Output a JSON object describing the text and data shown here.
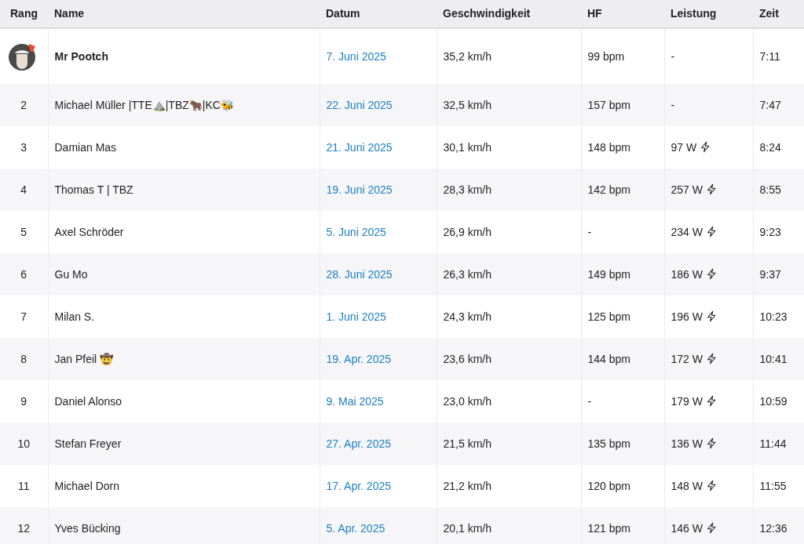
{
  "table": {
    "columns": [
      "Rang",
      "Name",
      "Datum",
      "Geschwindigkeit",
      "HF",
      "Leistung",
      "Zeit"
    ],
    "rows": [
      {
        "kind": "own",
        "name": "Mr Pootch",
        "date": "7. Juni 2025",
        "speed": "35,2 km/h",
        "hr": "99 bpm",
        "power": "-",
        "power_icon": false,
        "time": "7:11"
      },
      {
        "kind": "rank",
        "rank": "2",
        "name": "Michael Müller |TTE⛰️|TBZ🐂|KC🐝",
        "date": "22. Juni 2025",
        "speed": "32,5 km/h",
        "hr": "157 bpm",
        "power": "-",
        "power_icon": false,
        "time": "7:47"
      },
      {
        "kind": "rank",
        "rank": "3",
        "name": "Damian Mas",
        "date": "21. Juni 2025",
        "speed": "30,1 km/h",
        "hr": "148 bpm",
        "power": "97 W",
        "power_icon": true,
        "time": "8:24"
      },
      {
        "kind": "rank",
        "rank": "4",
        "name": "Thomas T | TBZ",
        "date": "19. Juni 2025",
        "speed": "28,3 km/h",
        "hr": "142 bpm",
        "power": "257 W",
        "power_icon": true,
        "time": "8:55"
      },
      {
        "kind": "rank",
        "rank": "5",
        "name": "Axel Schröder",
        "date": "5. Juni 2025",
        "speed": "26,9 km/h",
        "hr": "-",
        "power": "234 W",
        "power_icon": true,
        "time": "9:23"
      },
      {
        "kind": "rank",
        "rank": "6",
        "name": "Gu Mo",
        "date": "28. Juni 2025",
        "speed": "26,3 km/h",
        "hr": "149 bpm",
        "power": "186 W",
        "power_icon": true,
        "time": "9:37"
      },
      {
        "kind": "rank",
        "rank": "7",
        "name": "Milan S.",
        "date": "1. Juni 2025",
        "speed": "24,3 km/h",
        "hr": "125 bpm",
        "power": "196 W",
        "power_icon": true,
        "time": "10:23"
      },
      {
        "kind": "rank",
        "rank": "8",
        "name": "Jan Pfeil 🤠",
        "date": "19. Apr. 2025",
        "speed": "23,6 km/h",
        "hr": "144 bpm",
        "power": "172 W",
        "power_icon": true,
        "time": "10:41"
      },
      {
        "kind": "rank",
        "rank": "9",
        "name": "Daniel Alonso",
        "date": "9. Mai 2025",
        "speed": "23,0 km/h",
        "hr": "-",
        "power": "179 W",
        "power_icon": true,
        "time": "10:59"
      },
      {
        "kind": "rank",
        "rank": "10",
        "name": "Stefan Freyer",
        "date": "27. Apr. 2025",
        "speed": "21,5 km/h",
        "hr": "135 bpm",
        "power": "136 W",
        "power_icon": true,
        "time": "11:44"
      },
      {
        "kind": "rank",
        "rank": "11",
        "name": "Michael Dorn",
        "date": "17. Apr. 2025",
        "speed": "21,2 km/h",
        "hr": "120 bpm",
        "power": "148 W",
        "power_icon": true,
        "time": "11:55"
      },
      {
        "kind": "rank",
        "rank": "12",
        "name": "Yves Bücking",
        "date": "5. Apr. 2025",
        "speed": "20,1 km/h",
        "hr": "121 bpm",
        "power": "146 W",
        "power_icon": true,
        "time": "12:36"
      }
    ]
  }
}
